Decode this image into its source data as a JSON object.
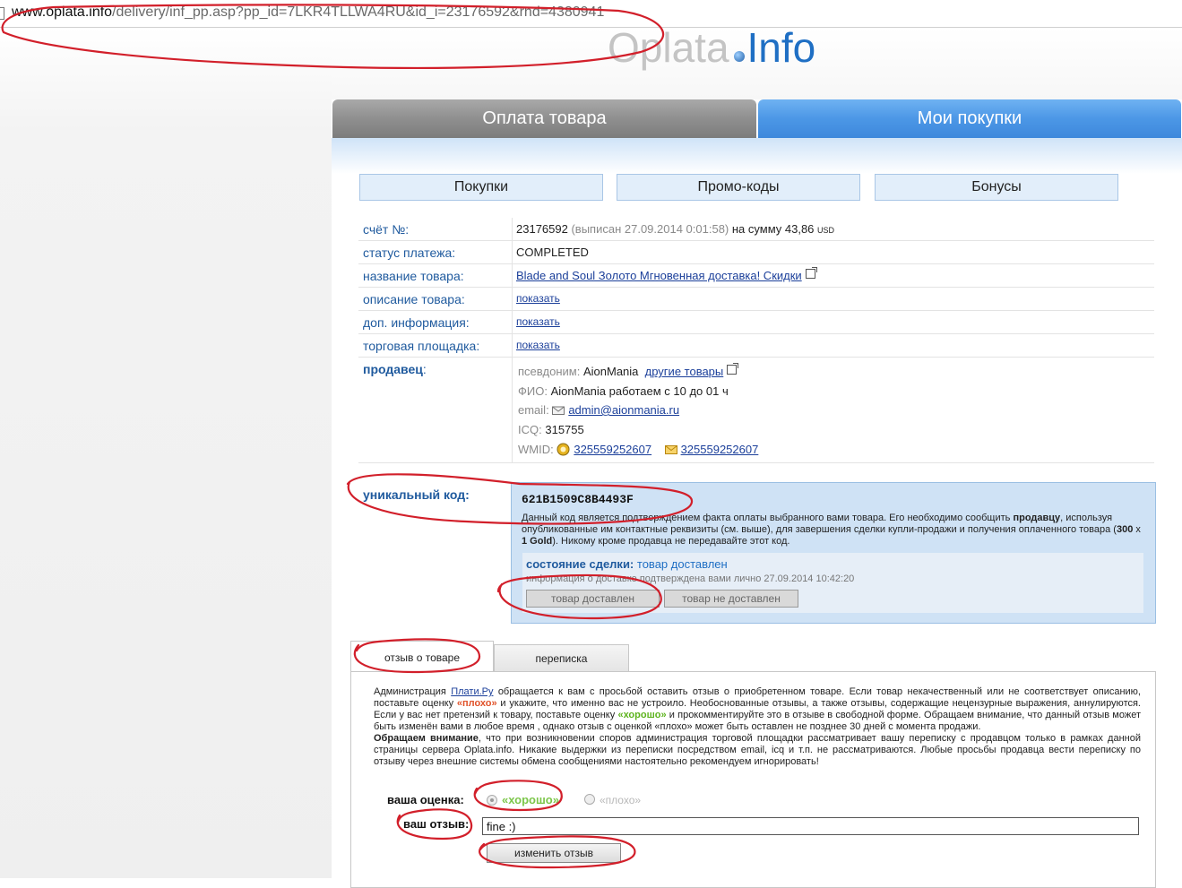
{
  "browser": {
    "url_host": "www.oplata.info",
    "url_rest": "/delivery/inf_pp.asp?pp_id=7LKR4TLLWA4RU&id_i=23176592&rnd=4380941"
  },
  "logo": {
    "part1": "Oplata",
    "part2": "Info"
  },
  "main_tabs": [
    "Оплата товара",
    "Мои покупки"
  ],
  "sub_buttons": [
    "Покупки",
    "Промо-коды",
    "Бонусы"
  ],
  "invoice": {
    "invoice_label": "счёт №:",
    "invoice_no": "23176592",
    "issued": "(выписан 27.09.2014 0:01:58)",
    "sum_text": "на сумму 43,86",
    "currency": "USD",
    "status_label": "статус платежа:",
    "status": "COMPLETED",
    "product_label": "название товара:",
    "product": "Blade and Soul Золото Мгновенная доставка! Скидки",
    "desc_label": "описание товара:",
    "desc_link": "показать",
    "extra_label": "доп. информация:",
    "extra_link": "показать",
    "market_label": "торговая площадка:",
    "market_link": "показать"
  },
  "seller": {
    "label": "продавец",
    "colon": ":",
    "alias_label": "псевдоним:",
    "alias": "AionMania",
    "other_goods": "другие товары",
    "fio_label": "ФИО:",
    "fio": "AionMania работаем с 10 до 01 ч",
    "email_label": "email:",
    "email": "admin@aionmania.ru",
    "icq_label": "ICQ:",
    "icq": "315755",
    "wmid_label": "WMID:",
    "wmid1": "325559252607",
    "wmid2": "325559252607"
  },
  "code": {
    "label": "уникальный код:",
    "value": "621B1509C8B4493F",
    "note_1": "Данный код является подтверждением факта оплаты выбранного вами товара. Его необходимо сообщить ",
    "note_seller": "продавцу",
    "note_2": ", используя опубликованные им контактные реквизиты (см. выше), для завершения сделки купли-продажи и получения оплаченного товара (",
    "note_qty": "300",
    "note_x": " x ",
    "note_item": "1 Gold",
    "note_3": "). Никому кроме продавца не передавайте этот код.",
    "deal_label": "состояние сделки:",
    "deal_status": "товар доставлен",
    "deal_info": "информация о доставке подтверждена вами лично 27.09.2014 10:42:20",
    "btn_delivered": "товар доставлен",
    "btn_not_delivered": "товар не доставлен"
  },
  "review_tabs": [
    "отзыв о товаре",
    "переписка"
  ],
  "review": {
    "p1_a": "Администрация ",
    "p1_link": "Плати.Ру",
    "p1_b": " обращается к вам с просьбой оставить отзыв о приобретенном товаре. Если товар некачественный или не соответствует описанию, поставьте оценку ",
    "p1_bad": "«плохо»",
    "p1_c": " и укажите, что именно вас не устроило. Необоснованные отзывы, а также отзывы, содержащие нецензурные выражения, аннулируются. Если у вас нет претензий к товару, поставьте оценку ",
    "p1_good": "«хорошо»",
    "p1_d": " и прокомментируйте это в отзыве в свободной форме. Обращаем внимание, что данный отзыв может быть изменён вами в любое время , однако отзыв с оценкой «плохо» может быть оставлен не позднее 30 дней с момента продажи.",
    "p2_bold": "Обращаем внимание",
    "p2_text": ", что при возникновении споров администрация торговой площадки рассматривает вашу переписку с продавцом только в рамках данной страницы сервера Oplata.info. Никакие выдержки из переписки посредством email, icq и т.п. не рассматриваются. Любые просьбы продавца вести переписку по отзыву через внешние системы обмена сообщениями настоятельно рекомендуем игнорировать!",
    "rating_label": "ваша оценка:",
    "opt_good": "«хорошо»",
    "opt_bad": "«плохо»",
    "review_label": "ваш отзыв:",
    "review_value": "fine :)",
    "change_button": "изменить отзыв"
  },
  "colors": {
    "accent_blue": "#4c97e6",
    "annotation_red": "#d21f2a",
    "good_green": "#5db31d",
    "bad_orange": "#e0522a"
  }
}
